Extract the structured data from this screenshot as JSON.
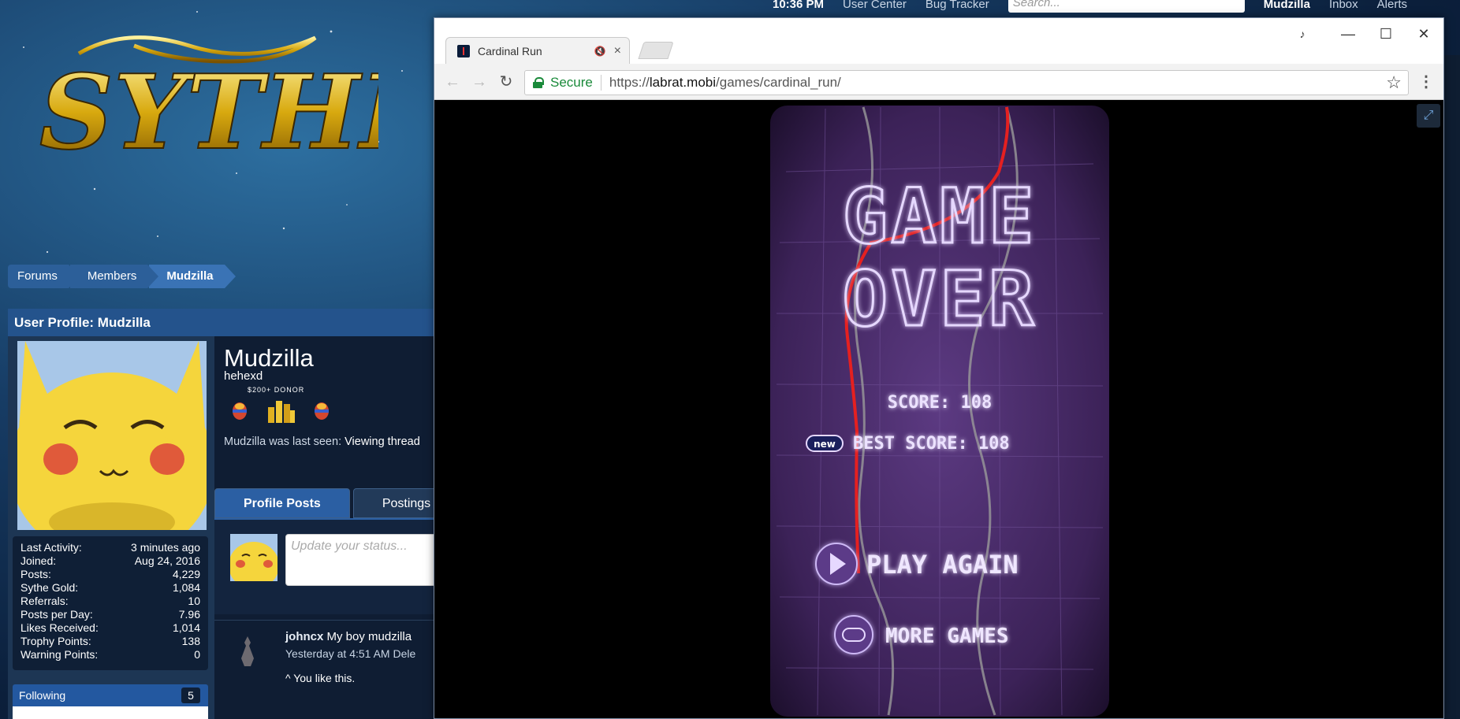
{
  "site": {
    "logo_text": "SYTHE",
    "topbar": {
      "clock": "10:36 PM",
      "user_center": "User Center",
      "bug_tracker": "Bug Tracker",
      "search_placeholder": "Search...",
      "username": "Mudzilla",
      "inbox": "Inbox",
      "alerts": "Alerts"
    },
    "breadcrumb": [
      "Forums",
      "Members",
      "Mudzilla"
    ],
    "profile": {
      "panel_title": "User Profile: Mudzilla",
      "username": "Mudzilla",
      "user_title": "hehexd",
      "donor_label": "$200+ DONOR",
      "last_seen_prefix": "Mudzilla was last seen:",
      "last_seen_value": "Viewing thread",
      "stats": [
        {
          "label": "Last Activity:",
          "value": "3 minutes ago"
        },
        {
          "label": "Joined:",
          "value": "Aug 24, 2016"
        },
        {
          "label": "Posts:",
          "value": "4,229"
        },
        {
          "label": "Sythe Gold:",
          "value": "1,084"
        },
        {
          "label": "Referrals:",
          "value": "10"
        },
        {
          "label": "Posts per Day:",
          "value": "7.96"
        },
        {
          "label": "Likes Received:",
          "value": "1,014"
        },
        {
          "label": "Trophy Points:",
          "value": "138"
        },
        {
          "label": "Warning Points:",
          "value": "0"
        }
      ],
      "following_label": "Following",
      "following_count": "5",
      "tabs": [
        "Profile Posts",
        "Postings"
      ],
      "status_placeholder": "Update your status...",
      "post": {
        "author": "johncx",
        "text": "My boy mudzilla",
        "time": "Yesterday at 4:51 AM",
        "delete": "Dele",
        "like_text": "You like this."
      }
    }
  },
  "browser": {
    "tab_title": "Cardinal Run",
    "secure_label": "Secure",
    "url_scheme": "https://",
    "url_host": "labrat.mobi",
    "url_path": "/games/cardinal_run/",
    "colors": {
      "secure": "#1a8a3a"
    }
  },
  "game": {
    "title_line1": "GAME",
    "title_line2": "OVER",
    "score_label": "SCORE: 108",
    "new_badge": "new",
    "best_score_label": "BEST SCORE: 108",
    "play_again_label": "PLAY AGAIN",
    "more_games_label": "MORE GAMES",
    "colors": {
      "background": "#4a2a6e",
      "neon": "#d9c7ff",
      "red_line": "#e52020"
    }
  }
}
